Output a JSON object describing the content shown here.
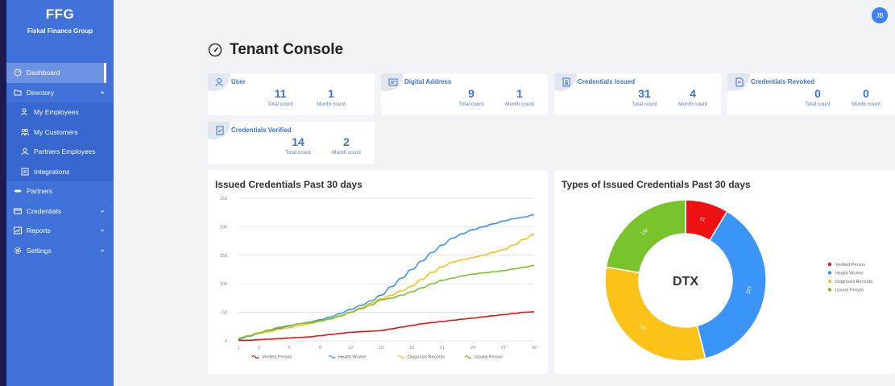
{
  "sidebar": {
    "logo": "FFG",
    "org_name": "Fiskal Finance Group",
    "items": [
      {
        "label": "Dashboard",
        "icon": "dashboard-icon"
      },
      {
        "label": "Directory",
        "icon": "folder-icon"
      },
      {
        "label": "My Employees",
        "icon": "users-icon"
      },
      {
        "label": "My Customers",
        "icon": "users-icon"
      },
      {
        "label": "Partners Employees",
        "icon": "user-icon"
      },
      {
        "label": "Integrations",
        "icon": "integrations-icon"
      },
      {
        "label": "Partners",
        "icon": "handshake-icon"
      },
      {
        "label": "Credentials",
        "icon": "card-icon"
      },
      {
        "label": "Reports",
        "icon": "chart-icon"
      },
      {
        "label": "Settings",
        "icon": "gear-icon"
      }
    ]
  },
  "header": {
    "avatar_initials": "JB",
    "title": "Tenant Console"
  },
  "cards": [
    {
      "label": "User",
      "total": "11",
      "month": "1",
      "total_label": "Total count",
      "month_label": "Month count"
    },
    {
      "label": "Digital Address",
      "total": "9",
      "month": "1",
      "total_label": "Total count",
      "month_label": "Month count"
    },
    {
      "label": "Credentials Issued",
      "total": "31",
      "month": "4",
      "total_label": "Total count",
      "month_label": "Month count"
    },
    {
      "label": "Credentials Revoked",
      "total": "0",
      "month": "0",
      "total_label": "Total count",
      "month_label": "Month count"
    },
    {
      "label": "Credentials Verified",
      "total": "14",
      "month": "2",
      "total_label": "Total count",
      "month_label": "Month count"
    }
  ],
  "colors": {
    "sidebar": "#3f71d8",
    "accent": "#3f71d8",
    "red": "#ee1111",
    "blue": "#3a95f7",
    "yellow": "#fbc318",
    "green": "#78c32c"
  },
  "chart_data": [
    {
      "type": "line",
      "title": "Issued Credentials Past 30 days",
      "x": [
        1,
        2,
        3,
        4,
        5,
        6,
        7,
        8,
        9,
        10,
        11,
        12,
        13,
        14,
        15,
        16,
        17,
        18,
        19,
        20,
        21,
        22,
        23,
        24,
        25,
        26,
        27,
        28,
        29,
        30
      ],
      "ylim": [
        0,
        250
      ],
      "yticks": [
        0,
        50,
        100,
        150,
        200,
        250
      ],
      "xticks": [
        1,
        3,
        6,
        9,
        12,
        15,
        18,
        21,
        24,
        27,
        30
      ],
      "grid": true,
      "legend_position": "bottom",
      "series": [
        {
          "name": "Verified Person",
          "color": "#ee1111",
          "values": [
            1,
            1,
            2,
            3,
            4,
            5,
            6,
            7,
            9,
            11,
            13,
            15,
            16,
            17,
            18,
            21,
            24,
            27,
            30,
            32,
            34,
            36,
            38,
            40,
            42,
            44,
            46,
            48,
            50,
            51
          ]
        },
        {
          "name": "Health Worker",
          "color": "#3a95f7",
          "values": [
            3,
            8,
            13,
            17,
            22,
            26,
            30,
            33,
            37,
            42,
            48,
            55,
            62,
            70,
            80,
            95,
            110,
            125,
            140,
            155,
            168,
            180,
            188,
            195,
            200,
            205,
            210,
            214,
            217,
            221
          ]
        },
        {
          "name": "Diagnosis Records",
          "color": "#fbc318",
          "values": [
            5,
            9,
            13,
            16,
            20,
            23,
            27,
            30,
            34,
            38,
            43,
            50,
            58,
            66,
            74,
            80,
            88,
            96,
            108,
            120,
            130,
            138,
            142,
            146,
            150,
            155,
            160,
            168,
            178,
            187
          ]
        },
        {
          "name": "Issued Person",
          "color": "#78c32c",
          "values": [
            4,
            9,
            14,
            19,
            24,
            27,
            30,
            32,
            35,
            39,
            44,
            50,
            56,
            63,
            72,
            75,
            80,
            86,
            93,
            100,
            106,
            110,
            114,
            117,
            119,
            121,
            123,
            126,
            129,
            132
          ]
        }
      ]
    },
    {
      "type": "pie",
      "title": "Types of Issued Credentials Past 30 days",
      "center_label": "DTX",
      "legend_position": "right",
      "slices": [
        {
          "name": "Verified Person",
          "value": 51,
          "color": "#ee1111"
        },
        {
          "name": "Health Worker",
          "value": 221,
          "color": "#3a95f7"
        },
        {
          "name": "Diagnosis Records",
          "value": 187,
          "color": "#fbc318"
        },
        {
          "name": "Issued Person",
          "value": 132,
          "color": "#78c32c"
        }
      ]
    }
  ]
}
